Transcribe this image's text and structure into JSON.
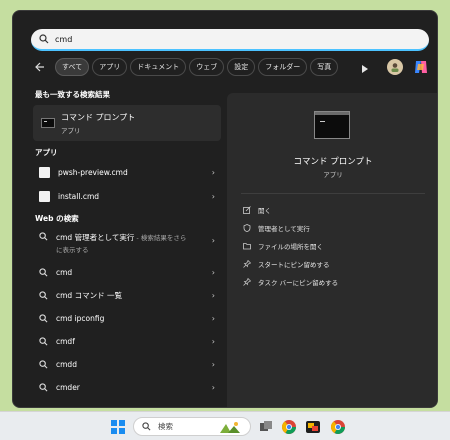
{
  "search": {
    "value": "cmd"
  },
  "filters": [
    "すべて",
    "アプリ",
    "ドキュメント",
    "ウェブ",
    "設定",
    "フォルダー",
    "写真"
  ],
  "best_match": {
    "heading": "最も一致する検索結果",
    "name": "コマンド プロンプト",
    "type": "アプリ"
  },
  "apps": {
    "heading": "アプリ",
    "items": [
      "pwsh-preview.cmd",
      "install.cmd"
    ]
  },
  "web": {
    "heading": "Web の検索",
    "first": {
      "main": "cmd 管理者として実行",
      "sep": " - 検索結果をさら",
      "line2": "に表示する"
    },
    "items": [
      "cmd",
      "cmd コマンド 一覧",
      "cmd ipconfig",
      "cmdf",
      "cmdd",
      "cmder"
    ]
  },
  "detail": {
    "title": "コマンド プロンプト",
    "subtitle": "アプリ",
    "actions": [
      "開く",
      "管理者として実行",
      "ファイルの場所を開く",
      "スタートにピン留めする",
      "タスク バーにピン留めする"
    ]
  },
  "taskbar": {
    "search_label": "検索"
  },
  "colors": {
    "accent": "#4cc2ff",
    "panel": "#202020",
    "desktop": "#c5dea0"
  }
}
